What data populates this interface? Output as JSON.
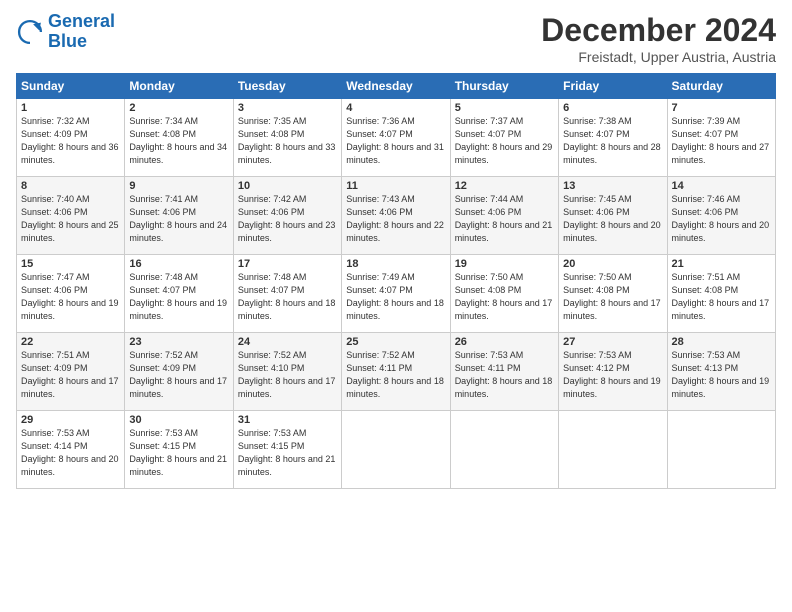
{
  "logo": {
    "line1": "General",
    "line2": "Blue"
  },
  "title": "December 2024",
  "subtitle": "Freistadt, Upper Austria, Austria",
  "weekdays": [
    "Sunday",
    "Monday",
    "Tuesday",
    "Wednesday",
    "Thursday",
    "Friday",
    "Saturday"
  ],
  "weeks": [
    [
      {
        "day": "1",
        "sunrise": "7:32 AM",
        "sunset": "4:09 PM",
        "daylight": "8 hours and 36 minutes."
      },
      {
        "day": "2",
        "sunrise": "7:34 AM",
        "sunset": "4:08 PM",
        "daylight": "8 hours and 34 minutes."
      },
      {
        "day": "3",
        "sunrise": "7:35 AM",
        "sunset": "4:08 PM",
        "daylight": "8 hours and 33 minutes."
      },
      {
        "day": "4",
        "sunrise": "7:36 AM",
        "sunset": "4:07 PM",
        "daylight": "8 hours and 31 minutes."
      },
      {
        "day": "5",
        "sunrise": "7:37 AM",
        "sunset": "4:07 PM",
        "daylight": "8 hours and 29 minutes."
      },
      {
        "day": "6",
        "sunrise": "7:38 AM",
        "sunset": "4:07 PM",
        "daylight": "8 hours and 28 minutes."
      },
      {
        "day": "7",
        "sunrise": "7:39 AM",
        "sunset": "4:07 PM",
        "daylight": "8 hours and 27 minutes."
      }
    ],
    [
      {
        "day": "8",
        "sunrise": "7:40 AM",
        "sunset": "4:06 PM",
        "daylight": "8 hours and 25 minutes."
      },
      {
        "day": "9",
        "sunrise": "7:41 AM",
        "sunset": "4:06 PM",
        "daylight": "8 hours and 24 minutes."
      },
      {
        "day": "10",
        "sunrise": "7:42 AM",
        "sunset": "4:06 PM",
        "daylight": "8 hours and 23 minutes."
      },
      {
        "day": "11",
        "sunrise": "7:43 AM",
        "sunset": "4:06 PM",
        "daylight": "8 hours and 22 minutes."
      },
      {
        "day": "12",
        "sunrise": "7:44 AM",
        "sunset": "4:06 PM",
        "daylight": "8 hours and 21 minutes."
      },
      {
        "day": "13",
        "sunrise": "7:45 AM",
        "sunset": "4:06 PM",
        "daylight": "8 hours and 20 minutes."
      },
      {
        "day": "14",
        "sunrise": "7:46 AM",
        "sunset": "4:06 PM",
        "daylight": "8 hours and 20 minutes."
      }
    ],
    [
      {
        "day": "15",
        "sunrise": "7:47 AM",
        "sunset": "4:06 PM",
        "daylight": "8 hours and 19 minutes."
      },
      {
        "day": "16",
        "sunrise": "7:48 AM",
        "sunset": "4:07 PM",
        "daylight": "8 hours and 19 minutes."
      },
      {
        "day": "17",
        "sunrise": "7:48 AM",
        "sunset": "4:07 PM",
        "daylight": "8 hours and 18 minutes."
      },
      {
        "day": "18",
        "sunrise": "7:49 AM",
        "sunset": "4:07 PM",
        "daylight": "8 hours and 18 minutes."
      },
      {
        "day": "19",
        "sunrise": "7:50 AM",
        "sunset": "4:08 PM",
        "daylight": "8 hours and 17 minutes."
      },
      {
        "day": "20",
        "sunrise": "7:50 AM",
        "sunset": "4:08 PM",
        "daylight": "8 hours and 17 minutes."
      },
      {
        "day": "21",
        "sunrise": "7:51 AM",
        "sunset": "4:08 PM",
        "daylight": "8 hours and 17 minutes."
      }
    ],
    [
      {
        "day": "22",
        "sunrise": "7:51 AM",
        "sunset": "4:09 PM",
        "daylight": "8 hours and 17 minutes."
      },
      {
        "day": "23",
        "sunrise": "7:52 AM",
        "sunset": "4:09 PM",
        "daylight": "8 hours and 17 minutes."
      },
      {
        "day": "24",
        "sunrise": "7:52 AM",
        "sunset": "4:10 PM",
        "daylight": "8 hours and 17 minutes."
      },
      {
        "day": "25",
        "sunrise": "7:52 AM",
        "sunset": "4:11 PM",
        "daylight": "8 hours and 18 minutes."
      },
      {
        "day": "26",
        "sunrise": "7:53 AM",
        "sunset": "4:11 PM",
        "daylight": "8 hours and 18 minutes."
      },
      {
        "day": "27",
        "sunrise": "7:53 AM",
        "sunset": "4:12 PM",
        "daylight": "8 hours and 19 minutes."
      },
      {
        "day": "28",
        "sunrise": "7:53 AM",
        "sunset": "4:13 PM",
        "daylight": "8 hours and 19 minutes."
      }
    ],
    [
      {
        "day": "29",
        "sunrise": "7:53 AM",
        "sunset": "4:14 PM",
        "daylight": "8 hours and 20 minutes."
      },
      {
        "day": "30",
        "sunrise": "7:53 AM",
        "sunset": "4:15 PM",
        "daylight": "8 hours and 21 minutes."
      },
      {
        "day": "31",
        "sunrise": "7:53 AM",
        "sunset": "4:15 PM",
        "daylight": "8 hours and 21 minutes."
      },
      null,
      null,
      null,
      null
    ]
  ]
}
